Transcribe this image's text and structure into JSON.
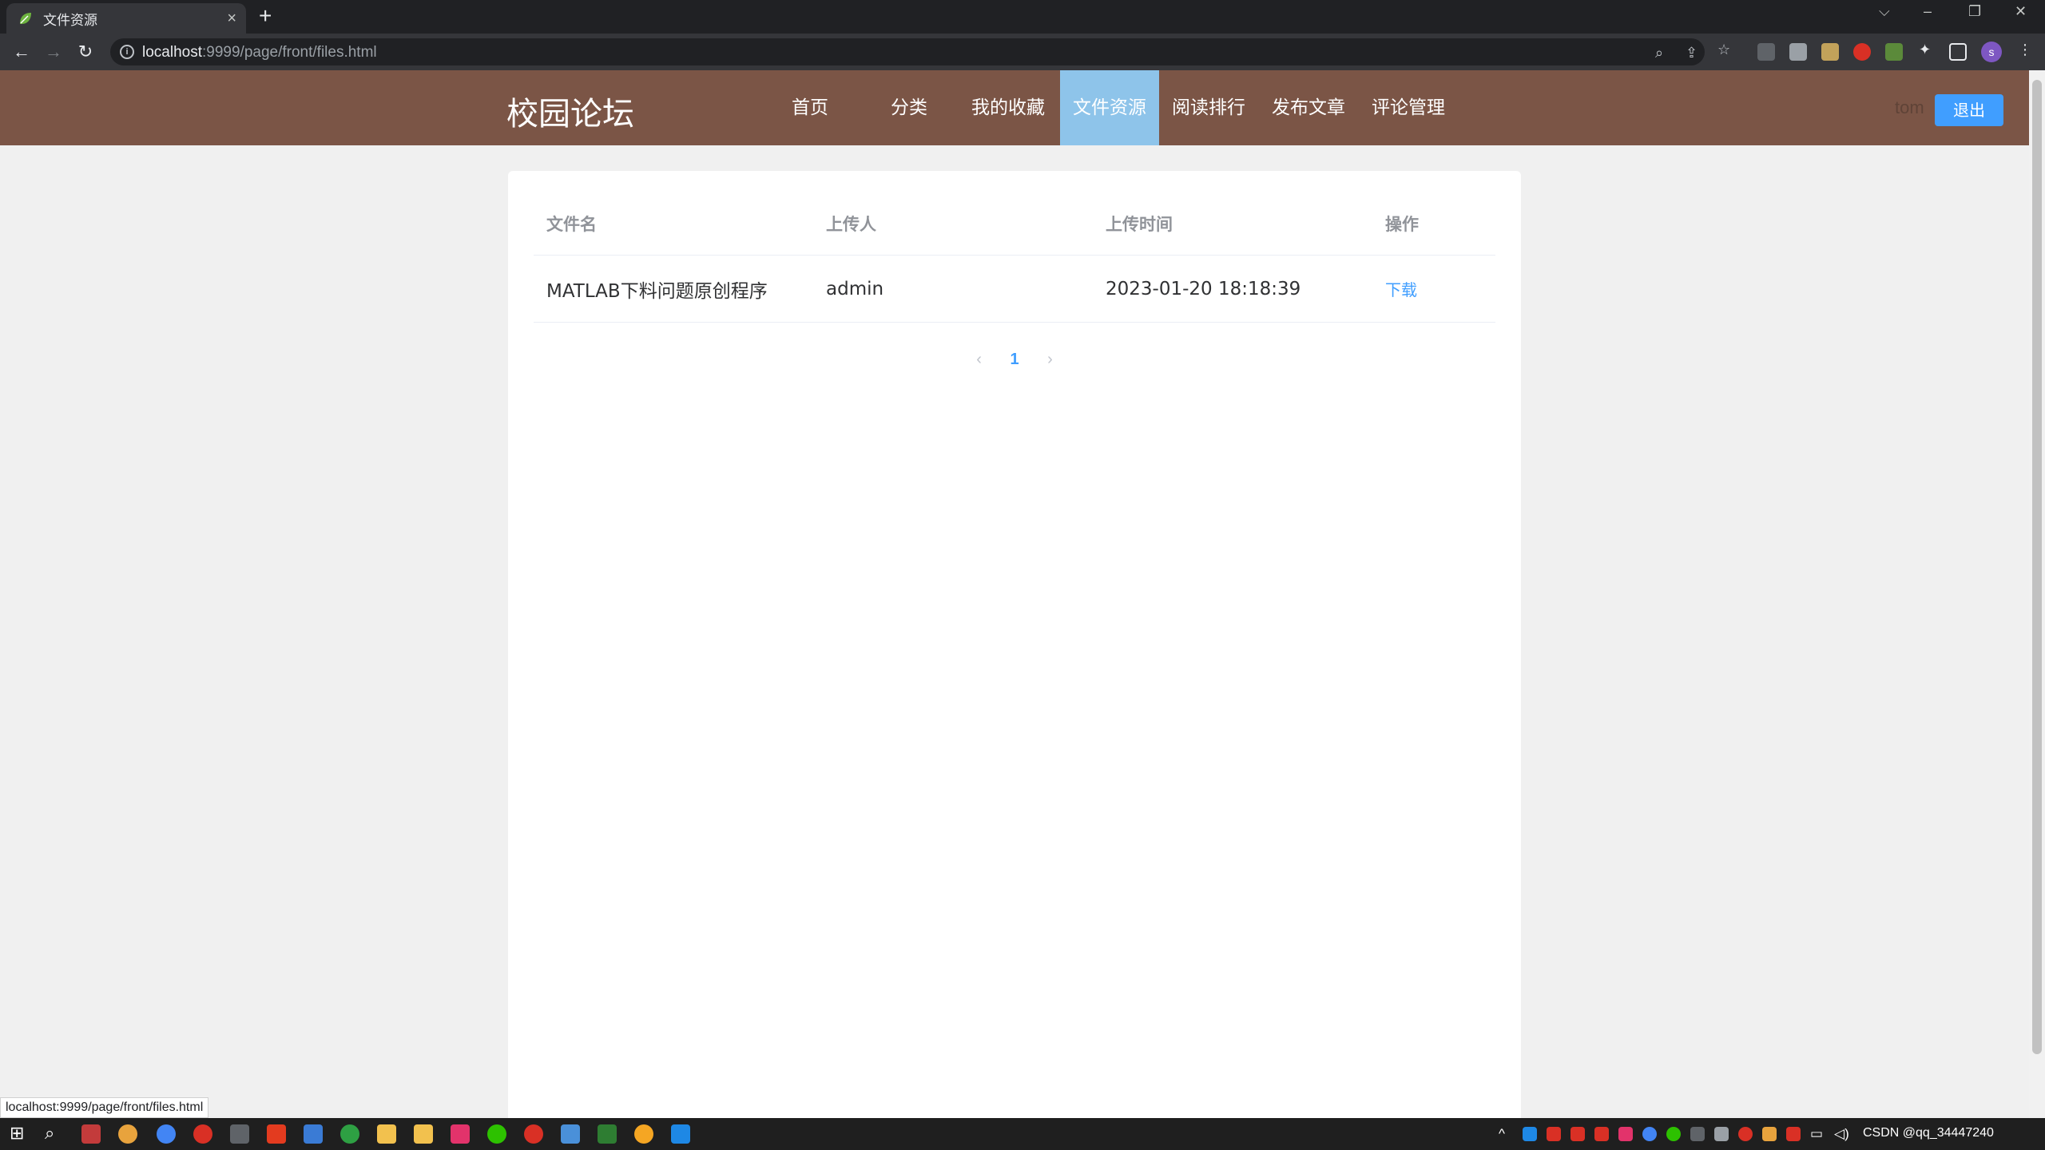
{
  "browser": {
    "tab_title": "文件资源",
    "tab_close": "×",
    "new_tab": "+",
    "url_host": "localhost",
    "url_rest": ":9999/page/front/files.html",
    "status_url": "localhost:9999/page/front/files.html",
    "profile_initial": "s",
    "window_controls": {
      "dropdown": "⌵",
      "minimize": "–",
      "restore": "❐",
      "close": "✕"
    }
  },
  "site": {
    "logo": "校园论坛",
    "nav": [
      {
        "label": "首页",
        "active": false
      },
      {
        "label": "分类",
        "active": false
      },
      {
        "label": "我的收藏",
        "active": false
      },
      {
        "label": "文件资源",
        "active": true
      },
      {
        "label": "阅读排行",
        "active": false
      },
      {
        "label": "发布文章",
        "active": false
      },
      {
        "label": "评论管理",
        "active": false
      }
    ],
    "username": "tom",
    "logout_label": "退出"
  },
  "table": {
    "headers": [
      "文件名",
      "上传人",
      "上传时间",
      "操作"
    ],
    "rows": [
      {
        "name": "MATLAB下料问题原创程序",
        "uploader": "admin",
        "time": "2023-01-20 18:18:39",
        "action": "下载"
      }
    ]
  },
  "pagination": {
    "prev": "‹",
    "current": "1",
    "next": "›"
  },
  "colors": {
    "header_bg": "#7b5546",
    "active_nav": "#8ec4ea",
    "primary": "#409eff"
  },
  "taskbar": {
    "tray_text": "CSDN @qq_34447240"
  }
}
